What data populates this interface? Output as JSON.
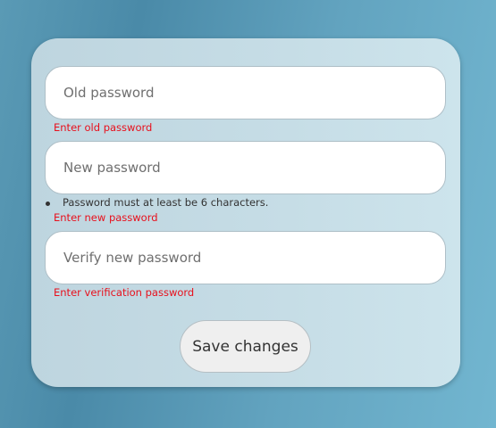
{
  "form": {
    "old_password": {
      "placeholder": "Old password",
      "value": "",
      "error": "Enter old password"
    },
    "new_password": {
      "placeholder": "New password",
      "value": "",
      "hint": "Password must at least be 6 characters.",
      "error": "Enter new password"
    },
    "verify_password": {
      "placeholder": "Verify new password",
      "value": "",
      "error": "Enter verification password"
    },
    "save_label": "Save changes"
  },
  "colors": {
    "error": "#e8101c",
    "button_bg": "#efefef"
  }
}
